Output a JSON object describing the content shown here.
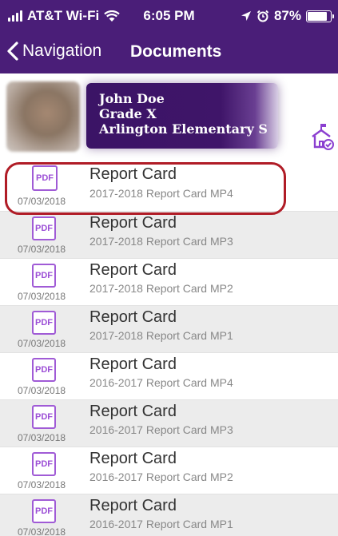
{
  "status_bar": {
    "carrier": "AT&T Wi-Fi",
    "time": "6:05 PM",
    "battery_percent_label": "87%",
    "battery_level": 0.87
  },
  "nav": {
    "back_label": "Navigation",
    "title": "Documents"
  },
  "student": {
    "name": "John Doe",
    "grade": "Grade X",
    "school": "Arlington Elementary S"
  },
  "documents": [
    {
      "icon_label": "PDF",
      "date": "07/03/2018",
      "title": "Report Card",
      "subtitle": "2017-2018 Report Card MP4"
    },
    {
      "icon_label": "PDF",
      "date": "07/03/2018",
      "title": "Report Card",
      "subtitle": "2017-2018 Report Card MP3"
    },
    {
      "icon_label": "PDF",
      "date": "07/03/2018",
      "title": "Report Card",
      "subtitle": "2017-2018 Report Card MP2"
    },
    {
      "icon_label": "PDF",
      "date": "07/03/2018",
      "title": "Report Card",
      "subtitle": "2017-2018 Report Card MP1"
    },
    {
      "icon_label": "PDF",
      "date": "07/03/2018",
      "title": "Report Card",
      "subtitle": "2016-2017 Report Card MP4"
    },
    {
      "icon_label": "PDF",
      "date": "07/03/2018",
      "title": "Report Card",
      "subtitle": "2016-2017 Report Card MP3"
    },
    {
      "icon_label": "PDF",
      "date": "07/03/2018",
      "title": "Report Card",
      "subtitle": "2016-2017 Report Card MP2"
    },
    {
      "icon_label": "PDF",
      "date": "07/03/2018",
      "title": "Report Card",
      "subtitle": "2016-2017 Report Card MP1"
    }
  ],
  "colors": {
    "header_purple": "#4a1e78",
    "pdf_icon_purple": "#a05bd6",
    "highlight_red": "#b01c26",
    "alt_row_gray": "#ececec"
  },
  "icons": [
    "signal-icon",
    "wifi-icon",
    "location-arrow-icon",
    "alarm-icon",
    "battery-icon",
    "chevron-left-icon",
    "school-house-icon",
    "pdf-icon"
  ]
}
